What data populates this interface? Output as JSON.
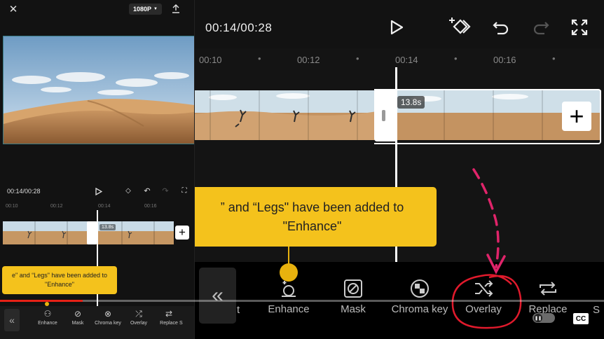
{
  "left_panel": {
    "resolution": "1080P",
    "timer": "00:14/00:28",
    "ruler_ticks": [
      "00:10",
      "00:12",
      "00:14",
      "00:16"
    ],
    "clip_duration": "13.8s",
    "tooltip": "e\" and “Legs\" have been added to \"Enhance\"",
    "toolbar": [
      "Enhance",
      "Mask",
      "Chroma key",
      "Overlay",
      "Replace",
      "S"
    ]
  },
  "right_panel": {
    "timer": "00:14/00:28",
    "ruler_ticks": [
      "00:10",
      "00:12",
      "00:14",
      "00:16"
    ],
    "clip_duration": "13.8s",
    "tooltip_line1": "” and “Legs\" have been added to",
    "tooltip_line2": "\"Enhance\"",
    "toolbar": {
      "partial": "t",
      "enhance": "Enhance",
      "mask": "Mask",
      "chroma_key": "Chroma key",
      "overlay": "Overlay",
      "replace": "Replace",
      "s": "S"
    }
  },
  "video_player": {
    "progress": 0.137,
    "cc_label": "CC"
  },
  "colors": {
    "tooltip": "#f4c21c",
    "progress": "#e62117",
    "annotation": "#e01a2c"
  }
}
